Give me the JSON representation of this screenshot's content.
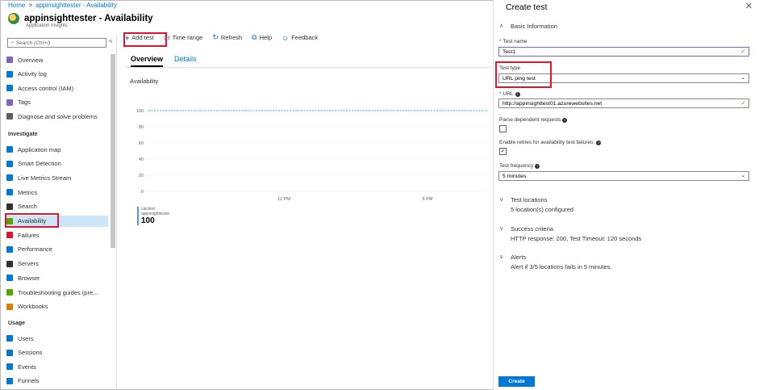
{
  "breadcrumb": {
    "home": "Home",
    "sep": ">",
    "current": "appinsighttester - Availability"
  },
  "resource": {
    "title": "appinsighttester - Availability",
    "subtitle": "Application Insights"
  },
  "nav": {
    "search_placeholder": "Search (Ctrl+/)",
    "collapse": "«",
    "items": [
      {
        "label": "Overview",
        "color": "#8661c5"
      },
      {
        "label": "Activity log",
        "color": "#0078d4"
      },
      {
        "label": "Access control (IAM)",
        "color": "#0078d4"
      },
      {
        "label": "Tags",
        "color": "#8661c5"
      },
      {
        "label": "Diagnose and solve problems",
        "color": "#605e5c"
      }
    ],
    "section_investigate": "Investigate",
    "investigate": [
      {
        "label": "Application map",
        "color": "#0078d4"
      },
      {
        "label": "Smart Detection",
        "color": "#0078d4"
      },
      {
        "label": "Live Metrics Stream",
        "color": "#0078d4"
      },
      {
        "label": "Metrics",
        "color": "#0078d4"
      },
      {
        "label": "Search",
        "color": "#323130"
      },
      {
        "label": "Availability",
        "color": "#57a300"
      },
      {
        "label": "Failures",
        "color": "#e0142d"
      },
      {
        "label": "Performance",
        "color": "#0078d4"
      },
      {
        "label": "Servers",
        "color": "#323130"
      },
      {
        "label": "Browser",
        "color": "#0078d4"
      },
      {
        "label": "Troubleshooting guides (pre...",
        "color": "#57a300"
      },
      {
        "label": "Workbooks",
        "color": "#d87e00"
      }
    ],
    "section_usage": "Usage",
    "usage": [
      {
        "label": "Users",
        "color": "#0078d4"
      },
      {
        "label": "Sessions",
        "color": "#0078d4"
      },
      {
        "label": "Events",
        "color": "#0078d4"
      },
      {
        "label": "Funnels",
        "color": "#0078d4"
      }
    ]
  },
  "toolbar": {
    "add_test": "Add test",
    "time_range": "Time range",
    "refresh": "Refresh",
    "help": "Help",
    "feedback": "Feedback"
  },
  "tabs": {
    "overview": "Overview",
    "details": "Details"
  },
  "availability_label": "Availability",
  "chart_data": {
    "type": "line",
    "y_ticks": [
      "100",
      "80",
      "60",
      "40",
      "20",
      "0"
    ],
    "x_ticks": [
      "12 PM",
      "6 PM"
    ],
    "ylim": [
      0,
      100
    ],
    "series": [
      {
        "name": "appinsighttester",
        "values": [
          100,
          100
        ]
      }
    ],
    "legend": {
      "line1": "calctest",
      "line2": "appinsighttester",
      "value": "100"
    }
  },
  "blade": {
    "title": "Create test",
    "close": "✕",
    "basic_info": "Basic Information",
    "test_name_label": "Test name",
    "test_name_value": "Test1",
    "test_type_label": "Test type",
    "test_type_value": "URL ping test",
    "url_label": "URL",
    "url_value": "http://appinsighttest01.azurewebsites.net",
    "parse_label": "Parse dependent requests",
    "retries_label": "Enable retries for availability test failures.",
    "freq_label": "Test frequency",
    "freq_value": "5 minutes",
    "locations_title": "Test locations",
    "locations_value": "5 location(s) configured",
    "success_title": "Success criteria",
    "success_value": "HTTP response: 200, Test Timeout: 120 seconds",
    "alerts_title": "Alerts",
    "alerts_value": "Alert if 3/5 locations fails in 5 minutes.",
    "create_button": "Create"
  }
}
